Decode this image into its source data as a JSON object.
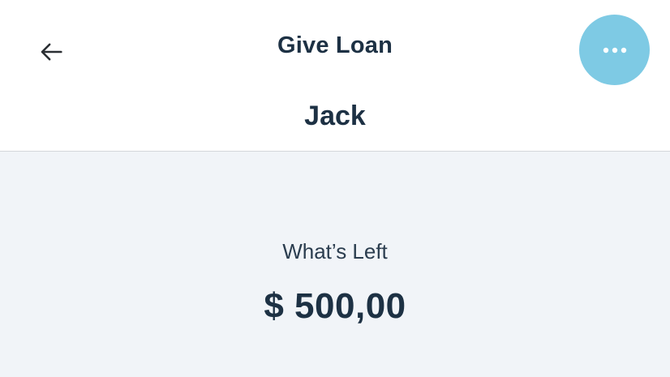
{
  "header": {
    "title": "Give Loan",
    "subtitle": "Jack",
    "back_icon": "arrow-left-icon",
    "more_icon": "more-horizontal-icon"
  },
  "balance": {
    "label": "What’s Left",
    "amount": "$ 500,00"
  },
  "colors": {
    "accent": "#7ecae4",
    "text": "#1d3144",
    "content_background": "#f1f4f8"
  }
}
